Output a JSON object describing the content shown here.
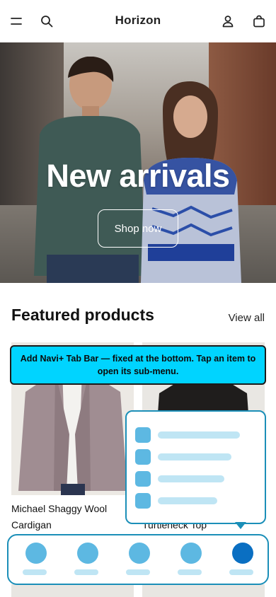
{
  "header": {
    "brand": "Horizon",
    "icons": [
      "menu-icon",
      "search-icon",
      "account-icon",
      "cart-icon"
    ]
  },
  "hero": {
    "title": "New arrivals",
    "button_label": "Shop now"
  },
  "featured": {
    "title": "Featured products",
    "view_all": "View all",
    "products": [
      {
        "name_line1": "Michael Shaggy Wool",
        "name_line2": "Cardigan"
      },
      {
        "name_line1": "Turtleneck Top"
      }
    ]
  },
  "banner": {
    "text": "Add Navi+ Tab Bar — fixed at the bottom. Tap an item to open its sub-menu."
  },
  "submenu": {
    "items": 4
  },
  "tabbar": {
    "tabs": 5,
    "active_index": 4
  },
  "colors": {
    "accent": "#1b8fb8",
    "tab_dot": "#5db8e2",
    "tab_active": "#0a6fc2",
    "banner": "#00d4ff"
  }
}
